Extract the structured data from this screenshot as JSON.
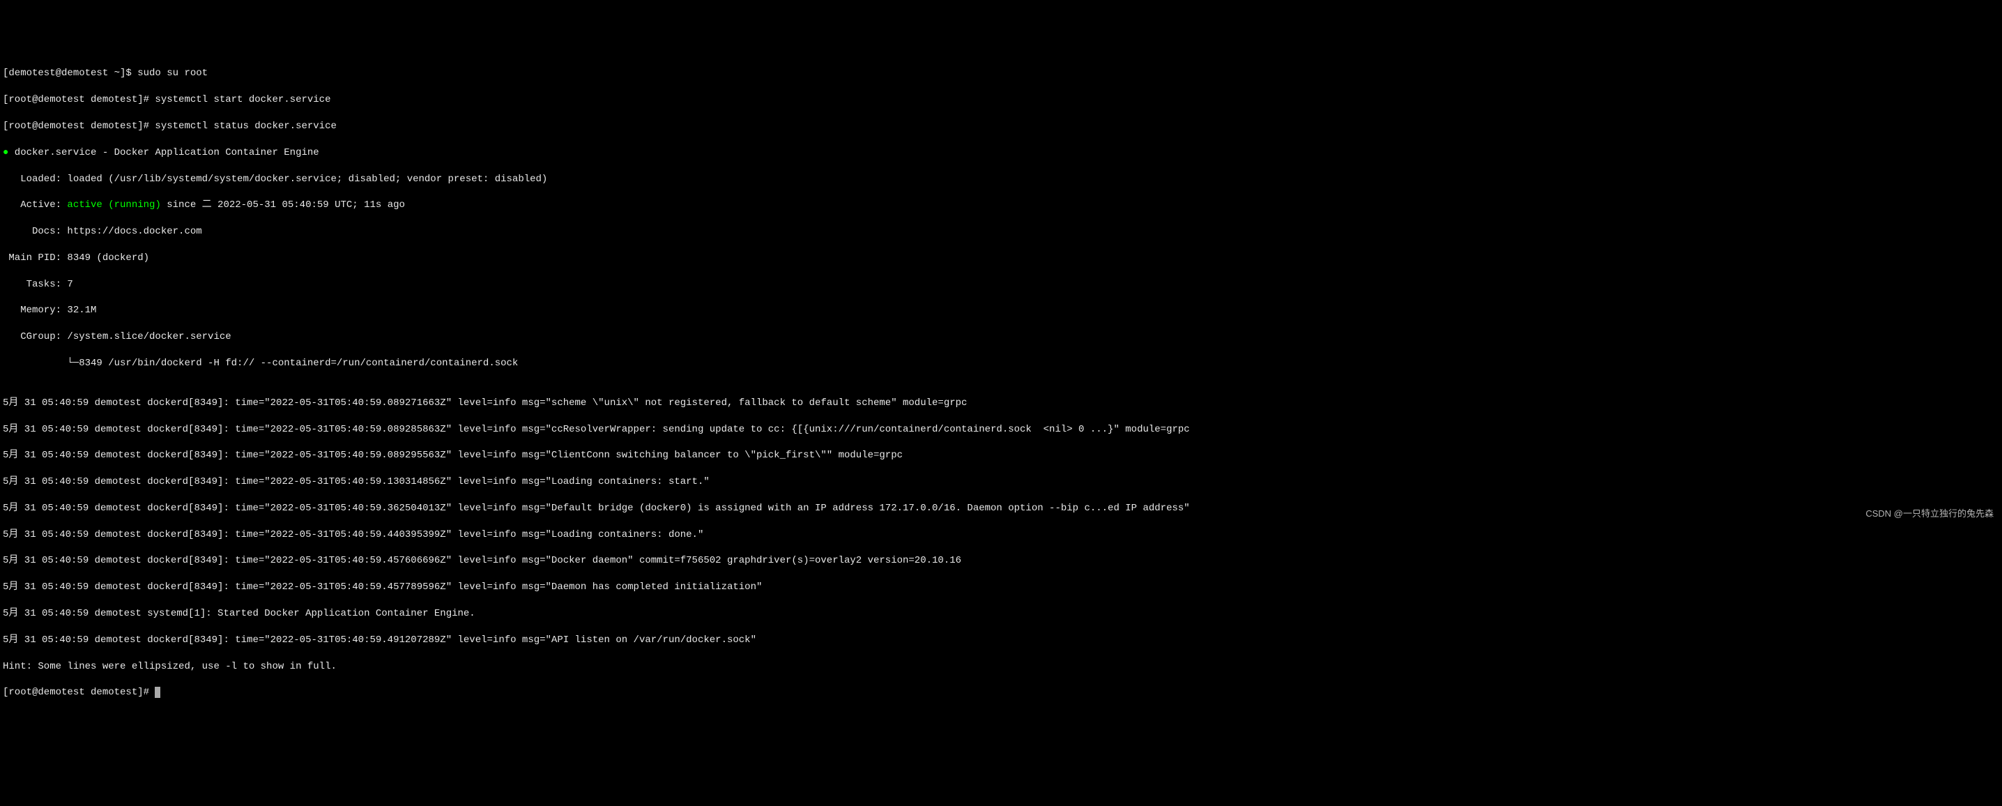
{
  "lines": {
    "l0": "[demotest@demotest ~]$ sudo su root",
    "l1": "[root@demotest demotest]# systemctl start docker.service",
    "l2": "[root@demotest demotest]# systemctl status docker.service",
    "l3_dot": "●",
    "l3": " docker.service - Docker Application Container Engine",
    "l4": "   Loaded: loaded (/usr/lib/systemd/system/docker.service; disabled; vendor preset: disabled)",
    "l5_prefix": "   Active: ",
    "l5_active": "active (running)",
    "l5_suffix": " since 二 2022-05-31 05:40:59 UTC; 11s ago",
    "l6": "     Docs: https://docs.docker.com",
    "l7": " Main PID: 8349 (dockerd)",
    "l8": "    Tasks: 7",
    "l9": "   Memory: 32.1M",
    "l10": "   CGroup: /system.slice/docker.service",
    "l11": "           └─8349 /usr/bin/dockerd -H fd:// --containerd=/run/containerd/containerd.sock",
    "l12": "",
    "l13": "5月 31 05:40:59 demotest dockerd[8349]: time=\"2022-05-31T05:40:59.089271663Z\" level=info msg=\"scheme \\\"unix\\\" not registered, fallback to default scheme\" module=grpc",
    "l14": "5月 31 05:40:59 demotest dockerd[8349]: time=\"2022-05-31T05:40:59.089285863Z\" level=info msg=\"ccResolverWrapper: sending update to cc: {[{unix:///run/containerd/containerd.sock  <nil> 0 ...}\" module=grpc",
    "l15": "5月 31 05:40:59 demotest dockerd[8349]: time=\"2022-05-31T05:40:59.089295563Z\" level=info msg=\"ClientConn switching balancer to \\\"pick_first\\\"\" module=grpc",
    "l16": "5月 31 05:40:59 demotest dockerd[8349]: time=\"2022-05-31T05:40:59.130314856Z\" level=info msg=\"Loading containers: start.\"",
    "l17": "5月 31 05:40:59 demotest dockerd[8349]: time=\"2022-05-31T05:40:59.362504013Z\" level=info msg=\"Default bridge (docker0) is assigned with an IP address 172.17.0.0/16. Daemon option --bip c...ed IP address\"",
    "l18": "5月 31 05:40:59 demotest dockerd[8349]: time=\"2022-05-31T05:40:59.440395399Z\" level=info msg=\"Loading containers: done.\"",
    "l19": "5月 31 05:40:59 demotest dockerd[8349]: time=\"2022-05-31T05:40:59.457606696Z\" level=info msg=\"Docker daemon\" commit=f756502 graphdriver(s)=overlay2 version=20.10.16",
    "l20": "5月 31 05:40:59 demotest dockerd[8349]: time=\"2022-05-31T05:40:59.457789596Z\" level=info msg=\"Daemon has completed initialization\"",
    "l21": "5月 31 05:40:59 demotest systemd[1]: Started Docker Application Container Engine.",
    "l22": "5月 31 05:40:59 demotest dockerd[8349]: time=\"2022-05-31T05:40:59.491207289Z\" level=info msg=\"API listen on /var/run/docker.sock\"",
    "l23": "Hint: Some lines were ellipsized, use -l to show in full.",
    "l24": "[root@demotest demotest]# "
  },
  "watermark": "CSDN @一只特立独行的兔先森"
}
